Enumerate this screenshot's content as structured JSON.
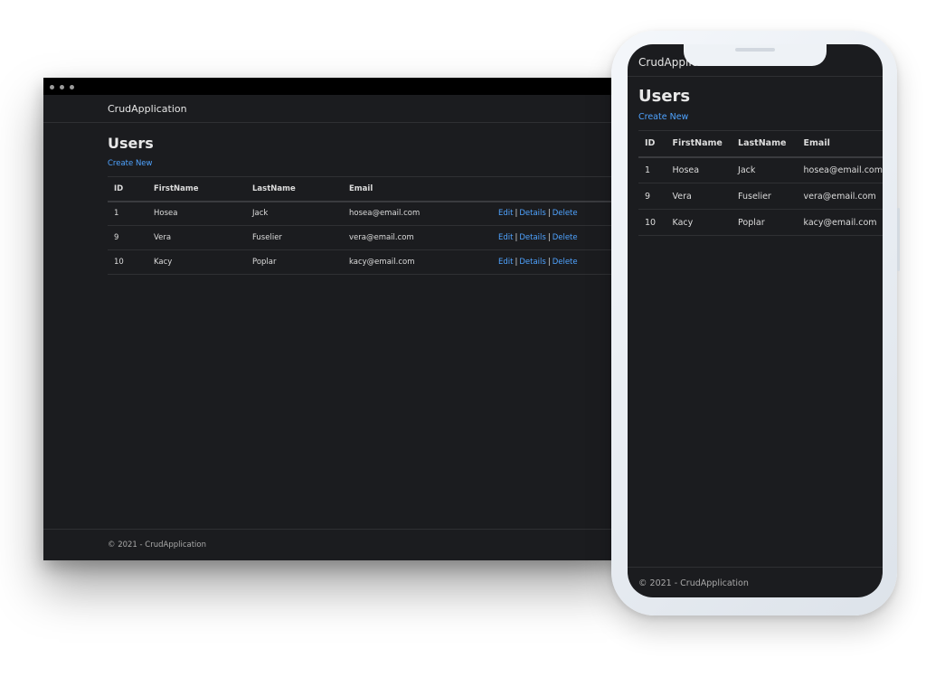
{
  "app": {
    "brand": "CrudApplication",
    "page_title": "Users",
    "create_link": "Create New",
    "footer": "© 2021 - CrudApplication"
  },
  "table": {
    "headers": [
      "ID",
      "FirstName",
      "LastName",
      "Email"
    ],
    "rows": [
      {
        "id": "1",
        "first": "Hosea",
        "last": "Jack",
        "email": "hosea@email.com"
      },
      {
        "id": "9",
        "first": "Vera",
        "last": "Fuselier",
        "email": "vera@email.com"
      },
      {
        "id": "10",
        "first": "Kacy",
        "last": "Poplar",
        "email": "kacy@email.com"
      }
    ],
    "actions": {
      "edit": "Edit",
      "details": "Details",
      "delete": "Delete",
      "separator": "|"
    }
  },
  "colors": {
    "background": "#1b1c1f",
    "link": "#4fa3ff",
    "text": "#dcdcdc",
    "titlebar": "#000000",
    "phone_frame": "#eef2f6"
  },
  "icons": {
    "window_controls": "traffic-light-dots"
  }
}
